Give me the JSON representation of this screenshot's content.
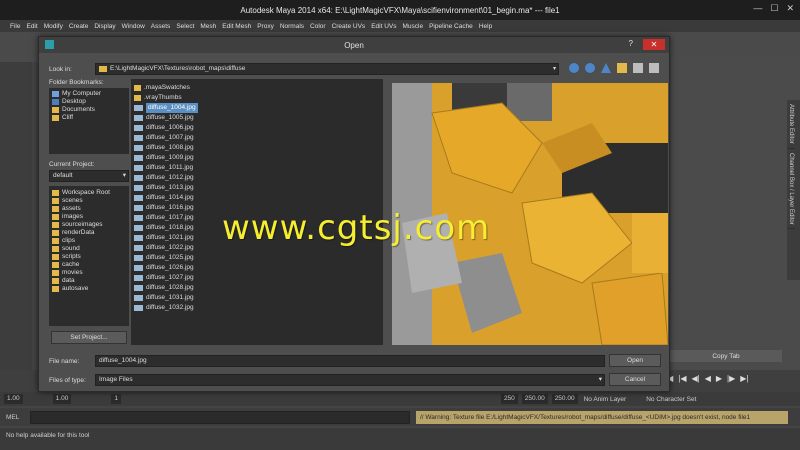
{
  "window": {
    "title": "Autodesk Maya 2014 x64: E:\\LightMagicVFX\\Maya\\scifienvironment\\01_begin.ma*   ---   file1"
  },
  "menubar": [
    "File",
    "Edit",
    "Modify",
    "Create",
    "Display",
    "Window",
    "Assets",
    "Select",
    "Mesh",
    "Edit Mesh",
    "Proxy",
    "Normals",
    "Color",
    "Create UVs",
    "Edit UVs",
    "Muscle",
    "Pipeline Cache",
    "Help"
  ],
  "dialog": {
    "title": "Open",
    "help": "?",
    "close": "✕",
    "look_in_label": "Look in:",
    "look_in_path": "E:\\LightMagicVFX\\Textures\\robot_maps\\diffuse",
    "bookmarks_label": "Folder Bookmarks:",
    "bookmarks": [
      "My Computer",
      "Desktop",
      "Documents",
      "Cliff"
    ],
    "current_project_label": "Current Project:",
    "current_project": "default",
    "project_folders": [
      "Workspace Root",
      "scenes",
      "assets",
      "images",
      "sourceimages",
      "renderData",
      "clips",
      "sound",
      "scripts",
      "cache",
      "movies",
      "data",
      "autosave"
    ],
    "set_project_button": "Set Project...",
    "files": [
      ".mayaSwatches",
      ".vrayThumbs",
      "diffuse_1004.jpg",
      "diffuse_1005.jpg",
      "diffuse_1006.jpg",
      "diffuse_1007.jpg",
      "diffuse_1008.jpg",
      "diffuse_1009.jpg",
      "diffuse_1011.jpg",
      "diffuse_1012.jpg",
      "diffuse_1013.jpg",
      "diffuse_1014.jpg",
      "diffuse_1016.jpg",
      "diffuse_1017.jpg",
      "diffuse_1018.jpg",
      "diffuse_1021.jpg",
      "diffuse_1022.jpg",
      "diffuse_1025.jpg",
      "diffuse_1026.jpg",
      "diffuse_1027.jpg",
      "diffuse_1028.jpg",
      "diffuse_1031.jpg",
      "diffuse_1032.jpg"
    ],
    "selected_file": "diffuse_1004.jpg",
    "file_name_label": "File name:",
    "file_name_value": "diffuse_1004.jpg",
    "file_type_label": "Files of type:",
    "file_type_value": "Image Files",
    "open_button": "Open",
    "cancel_button": "Cancel"
  },
  "right_tabs": [
    "Attribute Editor",
    "Channel Box / Layer Editor"
  ],
  "copy_tab": "Copy Tab",
  "range": {
    "start": "1.00",
    "start2": "1.00",
    "mid": "1",
    "end": "250",
    "end2": "250.00",
    "end3": "250.00",
    "anim_layer": "No Anim Layer",
    "char_set": "No Character Set"
  },
  "mel": {
    "label": "MEL",
    "warning": "// Warning: Texture file E:/LightMagicVFX/Textures/robot_maps/diffuse/diffuse_<UDIM>.jpg doesn't exist, node file1"
  },
  "help_line": "No help available for this tool",
  "watermark": "www.cgtsj.com",
  "colors": {
    "accent": "#5a8fc4",
    "watermark": "#f6ee2e",
    "texture_yellow": "#e9ad2f"
  }
}
